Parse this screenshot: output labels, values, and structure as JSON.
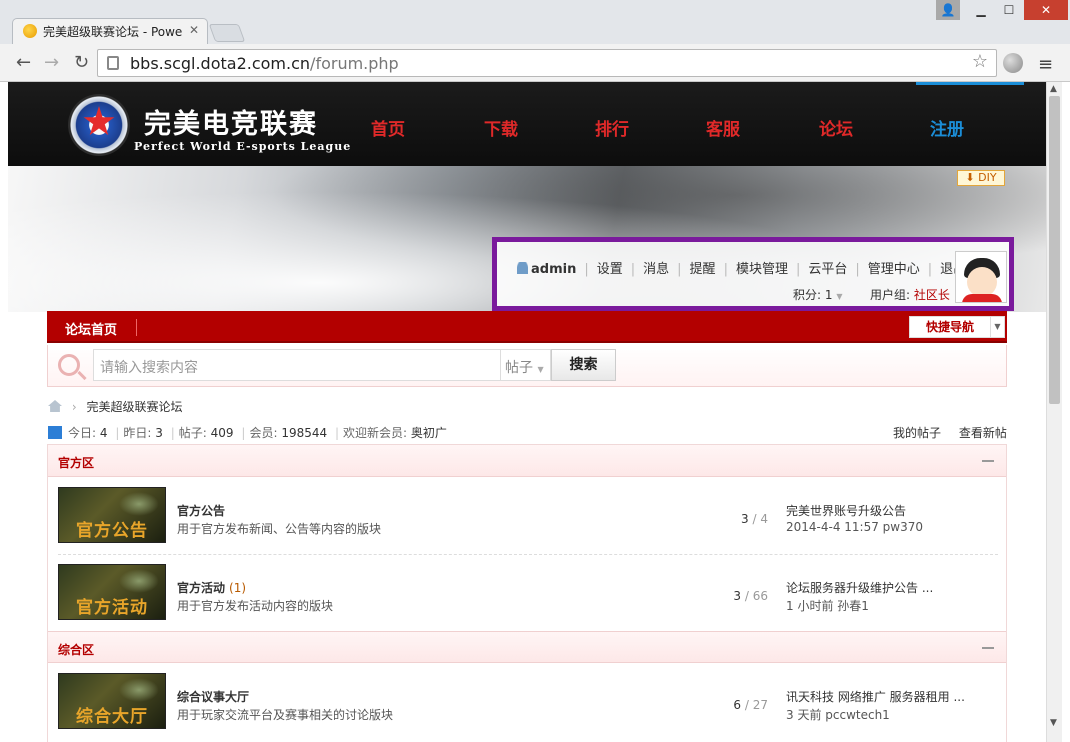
{
  "browser": {
    "tab_title": "完美超级联赛论坛 - Powe",
    "url_host": "bbs.scgl.dota2.com.cn",
    "url_path": "/forum.php"
  },
  "site": {
    "logo_title": "完美电竞联赛",
    "logo_subtitle": "Perfect World E-sports League",
    "nav": [
      "首页",
      "下载",
      "排行",
      "客服",
      "论坛",
      "注册"
    ],
    "diy_label": "DIY"
  },
  "user": {
    "name": "admin",
    "links": [
      "设置",
      "消息",
      "提醒",
      "模块管理",
      "云平台",
      "管理中心",
      "退出"
    ],
    "points_label": "积分: 1",
    "group_label": "用户组:",
    "group_value": "社区长"
  },
  "forum_nav": {
    "home_label": "论坛首页",
    "quick_nav_label": "快捷导航"
  },
  "search": {
    "placeholder": "请输入搜索内容",
    "type_label": "帖子",
    "button_label": "搜索"
  },
  "breadcrumb": {
    "current": "完美超级联赛论坛"
  },
  "stats": {
    "today_label": "今日:",
    "today": "4",
    "yesterday_label": "昨日:",
    "yesterday": "3",
    "posts_label": "帖子:",
    "posts": "409",
    "members_label": "会员:",
    "members": "198544",
    "welcome_label": "欢迎新会员:",
    "new_member": "奥初广",
    "my_posts": "我的帖子",
    "new_posts": "查看新帖"
  },
  "categories": [
    {
      "name": "官方区",
      "forums": [
        {
          "icon_text": "官方公告",
          "title": "官方公告",
          "new_count": "",
          "desc": "用于官方发布新闻、公告等内容的版块",
          "threads": "3",
          "posts": "4",
          "last_title": "完美世界账号升级公告",
          "last_meta": "2014-4-4 11:57 pw370"
        },
        {
          "icon_text": "官方活动",
          "title": "官方活动",
          "new_count": "(1)",
          "desc": "用于官方发布活动内容的版块",
          "threads": "3",
          "posts": "66",
          "last_title": "论坛服务器升级维护公告 ...",
          "last_meta": "1 小时前 孙春1"
        }
      ]
    },
    {
      "name": "综合区",
      "forums": [
        {
          "icon_text": "综合大厅",
          "title": "综合议事大厅",
          "new_count": "",
          "desc": "用于玩家交流平台及赛事相关的讨论版块",
          "threads": "6",
          "posts": "27",
          "last_title": "讯天科技 网络推广 服务器租用 ...",
          "last_meta": "3 天前 pccwtech1"
        }
      ]
    }
  ],
  "colors": {
    "nav_red": "#e02929",
    "nav_active": "#1b8ed8",
    "forum_bar": "#b30000",
    "highlight_box": "#7a1a9c"
  }
}
